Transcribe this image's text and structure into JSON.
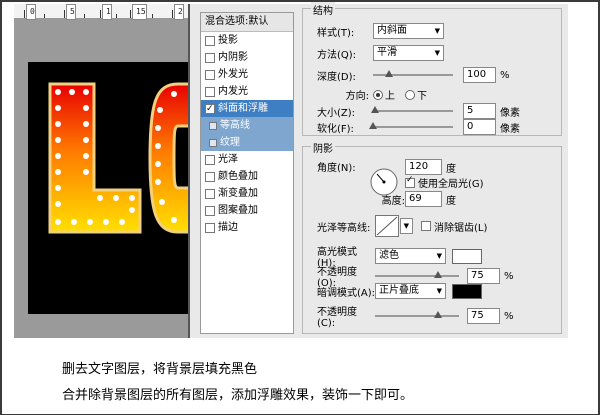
{
  "ruler": {
    "marks": [
      "0",
      "5",
      "1",
      "15",
      "2"
    ]
  },
  "styles_panel": {
    "header": "混合选项:默认",
    "items": [
      {
        "label": "投影",
        "checked": false
      },
      {
        "label": "内阴影",
        "checked": false
      },
      {
        "label": "外发光",
        "checked": false
      },
      {
        "label": "内发光",
        "checked": false
      },
      {
        "label": "斜面和浮雕",
        "checked": true,
        "selected": true
      },
      {
        "label": "等高线",
        "checked": false,
        "sub": true
      },
      {
        "label": "纹理",
        "checked": false,
        "sub": true
      },
      {
        "label": "光泽",
        "checked": false
      },
      {
        "label": "颜色叠加",
        "checked": false
      },
      {
        "label": "渐变叠加",
        "checked": false
      },
      {
        "label": "图案叠加",
        "checked": false
      },
      {
        "label": "描边",
        "checked": false
      }
    ]
  },
  "structure": {
    "title": "结构",
    "style_label": "样式(T):",
    "style_value": "内斜面",
    "technique_label": "方法(Q):",
    "technique_value": "平滑",
    "depth_label": "深度(D):",
    "depth_value": "100",
    "depth_unit": "%",
    "direction_label": "方向:",
    "dir_up": "上",
    "dir_down": "下",
    "size_label": "大小(Z):",
    "size_value": "5",
    "size_unit": "像素",
    "soften_label": "软化(F):",
    "soften_value": "0",
    "soften_unit": "像素"
  },
  "shading": {
    "title": "阴影",
    "angle_label": "角度(N):",
    "angle_value": "120",
    "angle_unit": "度",
    "global_light_label": "使用全局光(G)",
    "altitude_label": "高度:",
    "altitude_value": "69",
    "altitude_unit": "度",
    "gloss_label": "光泽等高线:",
    "antialias_label": "消除锯齿(L)",
    "highlight_label": "高光模式(H):",
    "highlight_value": "滤色",
    "highlight_opacity_label": "不透明度(O):",
    "highlight_opacity_value": "75",
    "highlight_opacity_unit": "%",
    "shadow_label": "暗调模式(A):",
    "shadow_value": "正片叠底",
    "shadow_opacity_label": "不透明度(C):",
    "shadow_opacity_value": "75",
    "shadow_opacity_unit": "%",
    "highlight_color": "#ffffff",
    "shadow_color": "#000000"
  },
  "caption": {
    "line1": "删去文字图层，将背景层填充黑色",
    "line2": "合并除背景图层的所有图层，添加浮雕效果，装饰一下即可。"
  }
}
